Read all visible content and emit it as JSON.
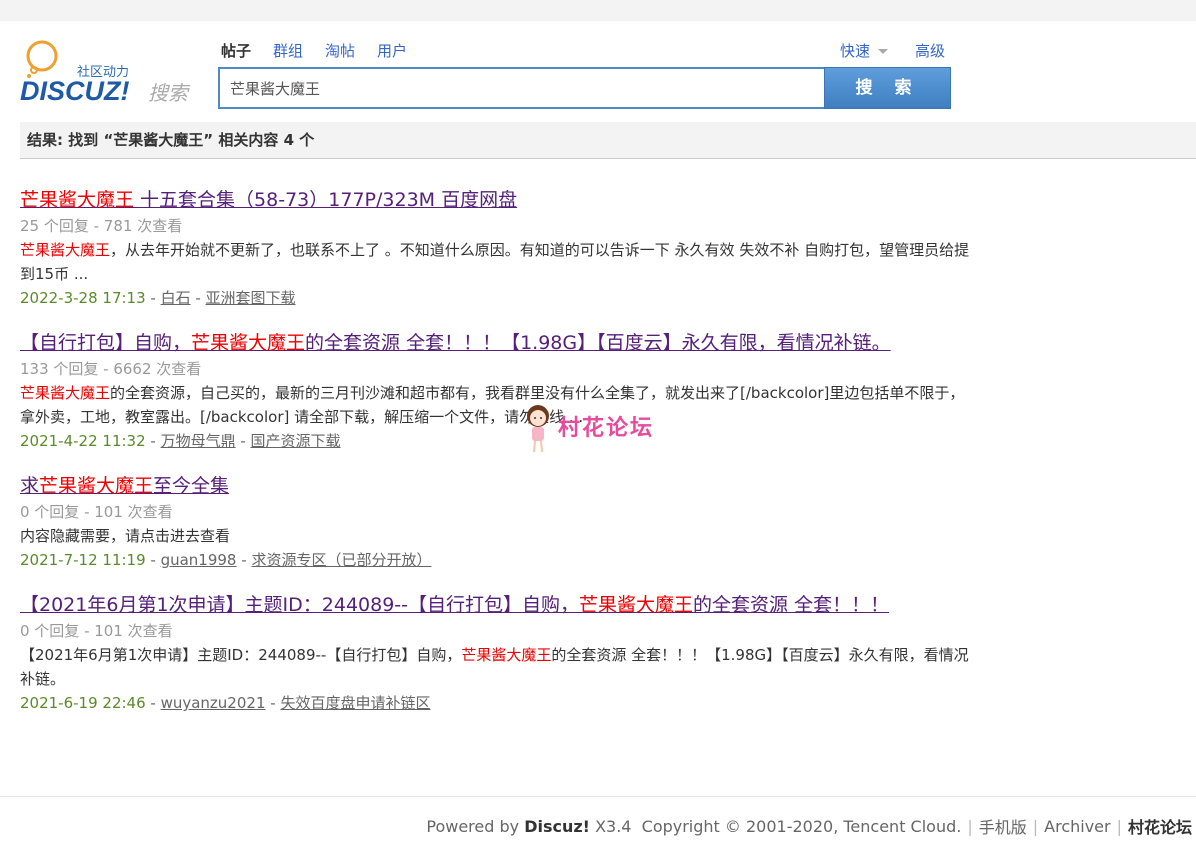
{
  "header": {
    "logo_tagline": "社区动力",
    "logo_brand": "DISCUZ!",
    "logo_suffix": "搜索",
    "tabs": [
      {
        "label": "帖子",
        "active": true
      },
      {
        "label": "群组",
        "active": false
      },
      {
        "label": "淘帖",
        "active": false
      },
      {
        "label": "用户",
        "active": false
      }
    ],
    "quick_label": "快速",
    "advanced_label": "高级",
    "search_value": "芒果酱大魔王",
    "search_button": "搜 索"
  },
  "summary": {
    "text": "结果: 找到 “芒果酱大魔王” 相关内容 4 个"
  },
  "keyword": "芒果酱大魔王",
  "results": [
    {
      "title_before": "",
      "title_kw": "芒果酱大魔王",
      "title_after": " 十五套合集（58-73）177P/323M 百度网盘",
      "meta": "25 个回复 - 781 次查看",
      "snippet_before": "",
      "snippet_kw": "芒果酱大魔王",
      "snippet_after": "，从去年开始就不更新了，也联系不上了 。不知道什么原因。有知道的可以告诉一下 永久有效 失效不补 自购打包，望管理员给提到15币 ...",
      "date": "2022-3-28 17:13",
      "author": "白石",
      "forum": "亚洲套图下载"
    },
    {
      "title_before": "【自行打包】自购，",
      "title_kw": "芒果酱大魔王",
      "title_after": "的全套资源 全套！！！【1.98G】【百度云】永久有限，看情况补链。",
      "meta": "133 个回复 - 6662 次查看",
      "snippet_before": "",
      "snippet_kw": "芒果酱大魔王",
      "snippet_after": "的全套资源，自己买的，最新的三月刊沙滩和超市都有，我看群里没有什么全集了，就发出来了[/backcolor]里边包括单不限于，拿外卖，工地，教室露出。[/backcolor] 请全部下载，解压缩一个文件，请勿在线 ...",
      "date": "2021-4-22 11:32",
      "author": "万物母气鼎",
      "forum": "国产资源下载"
    },
    {
      "title_before": "求",
      "title_kw": "芒果酱大魔王",
      "title_after": "至今全集",
      "meta": "0 个回复 - 101 次查看",
      "snippet_before": "内容隐藏需要，请点击进去查看",
      "snippet_kw": "",
      "snippet_after": "",
      "date": "2021-7-12 11:19",
      "author": "guan1998",
      "forum": "求资源专区（已部分开放）"
    },
    {
      "title_before": "【2021年6月第1次申请】主题ID：244089--【自行打包】自购，",
      "title_kw": "芒果酱大魔王",
      "title_after": "的全套资源 全套！！！",
      "meta": "0 个回复 - 101 次查看",
      "snippet_before": "【2021年6月第1次申请】主题ID：244089--【自行打包】自购，",
      "snippet_kw": "芒果酱大魔王",
      "snippet_after": "的全套资源 全套！！！【1.98G】【百度云】永久有限，看情况补链。",
      "date": "2021-6-19 22:46",
      "author": "wuyanzu2021",
      "forum": "失效百度盘申请补链区"
    }
  ],
  "watermark_text": "村花论坛",
  "footer": {
    "powered_prefix": "Powered by",
    "powered_brand": "Discuz!",
    "version": "X3.4",
    "copyright": "Copyright © 2001-2020, Tencent Cloud.",
    "links": [
      "手机版",
      "Archiver",
      "村花论坛"
    ]
  },
  "colors": {
    "link_visited": "#56207a",
    "keyword": "#ee0000",
    "date": "#5a8a2a",
    "brand_blue": "#3f7fc1"
  }
}
